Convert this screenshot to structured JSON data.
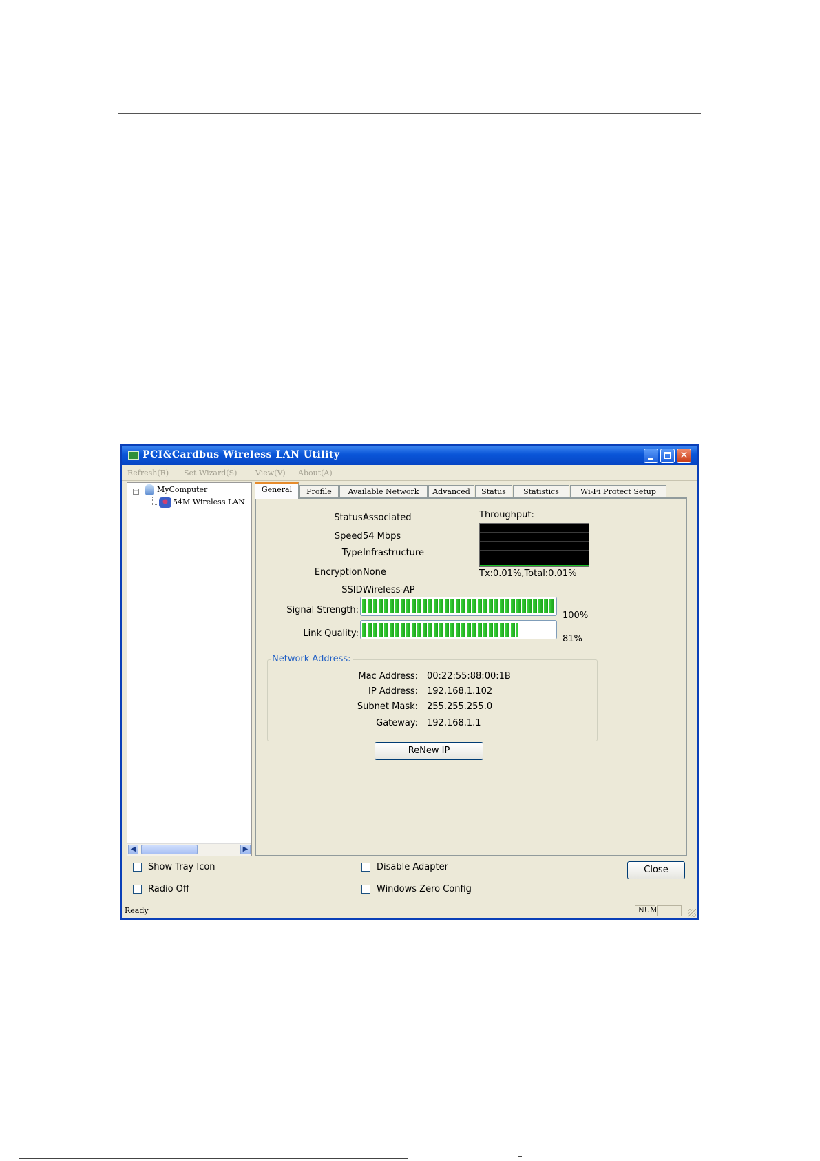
{
  "window": {
    "title": "PCI&Cardbus Wireless LAN Utility"
  },
  "menu": [
    "Refresh(R)",
    "Set Wizard(S)",
    "View(V)",
    "About(A)"
  ],
  "tree": {
    "root": "MyComputer",
    "child": "54M Wireless LAN"
  },
  "tabs": [
    "General",
    "Profile",
    "Available Network",
    "Advanced",
    "Status",
    "Statistics",
    "Wi-Fi Protect Setup"
  ],
  "active_tab": "General",
  "general": {
    "status_label": "Status:",
    "status_value": "Associated",
    "speed_label": "Speed:",
    "speed_value": "54 Mbps",
    "type_label": "Type:",
    "type_value": "Infrastructure",
    "encryption_label": "Encryption:",
    "encryption_value": "None",
    "ssid_label": "SSID:",
    "ssid_value": "Wireless-AP",
    "signal_label": "Signal Strength:",
    "signal_value": "100%",
    "signal_fraction": 1.0,
    "link_label": "Link Quality:",
    "link_value": "81%",
    "link_fraction": 0.81,
    "throughput_label": "Throughput:",
    "throughput_value": "Tx:0.01%,Total:0.01%"
  },
  "network_address": {
    "title": "Network Address:",
    "mac_label": "Mac Address:",
    "mac_value": "00:22:55:88:00:1B",
    "ip_label": "IP Address:",
    "ip_value": "192.168.1.102",
    "mask_label": "Subnet Mask:",
    "mask_value": "255.255.255.0",
    "gateway_label": "Gateway:",
    "gateway_value": "192.168.1.1"
  },
  "renew_button": "ReNew IP",
  "options": {
    "show_tray_icon": "Show Tray Icon",
    "radio_off": "Radio Off",
    "disable_adapter": "Disable Adapter",
    "windows_zero_config": "Windows Zero Config"
  },
  "close_button": "Close",
  "statusbar": {
    "text": "Ready",
    "num": "NUM"
  },
  "colors": {
    "titlebar": "#0a55d8",
    "meter_fill": "#1ca11c",
    "group_title": "#1d5dc4"
  }
}
